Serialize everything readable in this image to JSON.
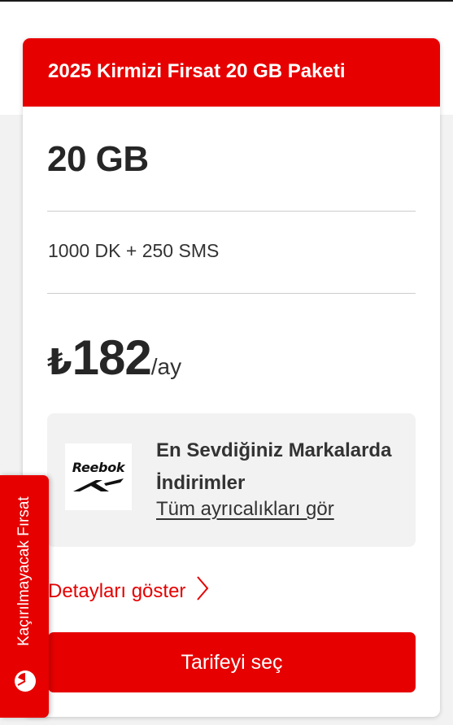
{
  "package": {
    "title": "2025 Kirmizi Firsat 20 GB Paketi",
    "data_amount": "20 GB",
    "minutes_sms": "1000 DK + 250 SMS",
    "price": {
      "currency_symbol": "₺",
      "amount": "182",
      "period": "/ay"
    }
  },
  "promo": {
    "brand_logo_text": "Reebok",
    "title": "En Sevdiğiniz Markalarda İndirimler",
    "link_label": "Tüm ayrıcalıkları gör"
  },
  "details_link_label": "Detayları göster",
  "select_button_label": "Tarifeyi seç",
  "side_tab": {
    "label": "Kaçırılmayacak Fırsat",
    "icon": "timer-icon"
  },
  "colors": {
    "brand_red": "#e60000",
    "promo_bg": "#f2f2f2"
  }
}
